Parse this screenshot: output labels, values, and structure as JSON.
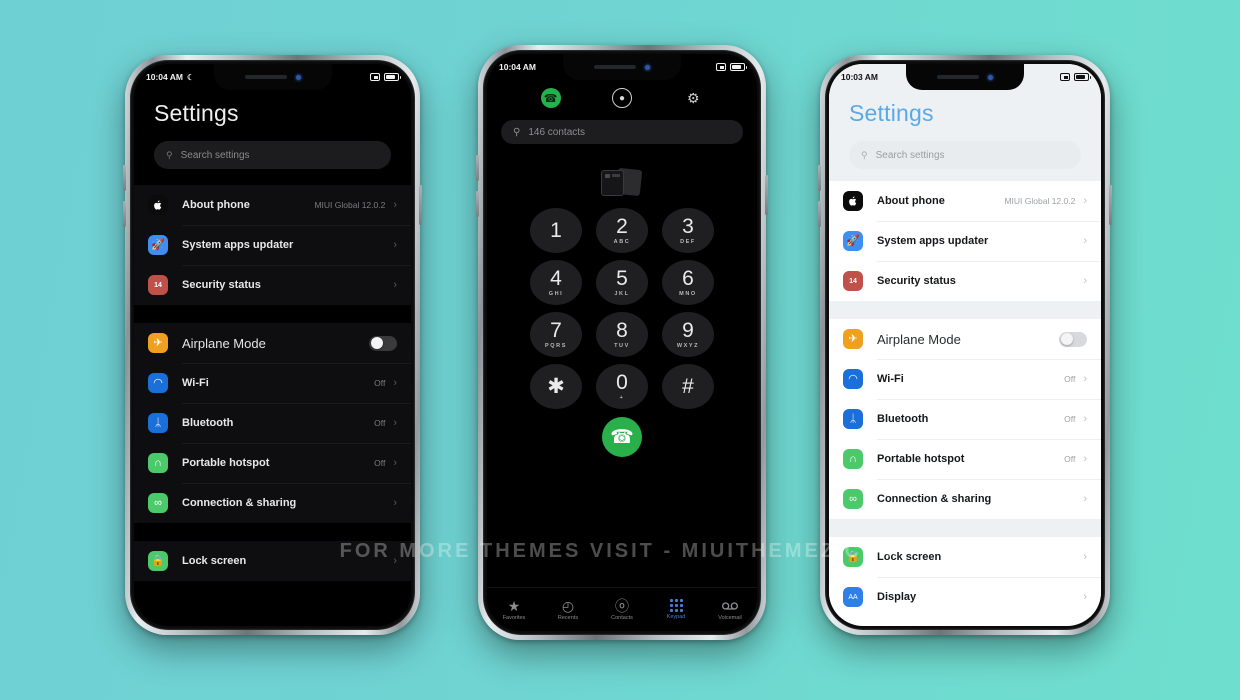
{
  "background": {
    "from": "#6FD0D4",
    "to": "#6EDECE"
  },
  "watermark": "FOR MORE THEMES VISIT - MIUITHEMEZ.COM",
  "phones": {
    "left": {
      "statusbar": {
        "time": "10:04 AM",
        "dnd_icon": "moon-icon",
        "right_icon": "screenshot-icon",
        "battery": "battery-icon"
      },
      "title": "Settings",
      "search_placeholder": "Search settings",
      "groups": [
        {
          "rows": [
            {
              "label": "About phone",
              "value": "MIUI Global 12.0.2",
              "icon": "apple-icon",
              "icon_bg": "#0b0b0b",
              "glyph": "",
              "chevron": "›"
            },
            {
              "label": "System apps updater",
              "value": "",
              "icon": "rocket-icon",
              "icon_bg": "#3f8ff0",
              "glyph": "🚀",
              "chevron": "›"
            },
            {
              "label": "Security status",
              "value": "",
              "icon": "security-14-icon",
              "icon_bg": "#c0504a",
              "glyph": "14",
              "chevron": "›"
            }
          ]
        },
        {
          "rows": [
            {
              "label": "Airplane Mode",
              "value": "",
              "icon": "airplane-icon",
              "icon_bg": "#f0a020",
              "glyph": "✈",
              "toggle": true,
              "light": true
            },
            {
              "label": "Wi-Fi",
              "value": "Off",
              "icon": "wifi-icon",
              "icon_bg": "#1b6fd8",
              "glyph": "◠",
              "chevron": "›"
            },
            {
              "label": "Bluetooth",
              "value": "Off",
              "icon": "bluetooth-icon",
              "icon_bg": "#1b6fd8",
              "glyph": "ᛦ",
              "chevron": "›"
            },
            {
              "label": "Portable hotspot",
              "value": "Off",
              "icon": "hotspot-icon",
              "icon_bg": "#4cc96a",
              "glyph": "∩",
              "chevron": "›"
            },
            {
              "label": "Connection & sharing",
              "value": "",
              "icon": "connection-sharing-icon",
              "icon_bg": "#4cc96a",
              "glyph": "∞",
              "chevron": "›"
            }
          ]
        },
        {
          "rows": [
            {
              "label": "Lock screen",
              "value": "",
              "icon": "lock-screen-icon",
              "icon_bg": "#4cc96a",
              "glyph": "🔒",
              "chevron": "›"
            }
          ]
        }
      ]
    },
    "middle": {
      "statusbar": {
        "time": "10:04 AM",
        "right_icon": "screenshot-icon",
        "battery": "battery-icon"
      },
      "header_icons": [
        {
          "name": "phone-icon",
          "glyph": "✆"
        },
        {
          "name": "contact-icon",
          "glyph": "●"
        },
        {
          "name": "gear-icon",
          "glyph": "⚙"
        }
      ],
      "search_text": "146 contacts",
      "keys": [
        {
          "num": "1",
          "letters": ""
        },
        {
          "num": "2",
          "letters": "ABC"
        },
        {
          "num": "3",
          "letters": "DEF"
        },
        {
          "num": "4",
          "letters": "GHI"
        },
        {
          "num": "5",
          "letters": "JKL"
        },
        {
          "num": "6",
          "letters": "MNO"
        },
        {
          "num": "7",
          "letters": "PQRS"
        },
        {
          "num": "8",
          "letters": "TUV"
        },
        {
          "num": "9",
          "letters": "WXYZ"
        },
        {
          "num": "✱",
          "letters": ""
        },
        {
          "num": "0",
          "letters": "+"
        },
        {
          "num": "#",
          "letters": ""
        }
      ],
      "call_button": "call-icon",
      "tabs": [
        {
          "label": "Favorites",
          "icon": "star-icon",
          "active": false
        },
        {
          "label": "Recents",
          "icon": "clock-icon",
          "active": false
        },
        {
          "label": "Contacts",
          "icon": "person-icon",
          "active": false
        },
        {
          "label": "Keypad",
          "icon": "keypad-icon",
          "active": true
        },
        {
          "label": "Voicemail",
          "icon": "voicemail-icon",
          "active": false
        }
      ]
    },
    "right": {
      "statusbar": {
        "time": "10:03 AM",
        "right_icon": "screenshot-icon",
        "battery": "battery-icon"
      },
      "title": "Settings",
      "title_color": "#5aa9e6",
      "search_placeholder": "Search settings",
      "groups": [
        {
          "rows": [
            {
              "label": "About phone",
              "value": "MIUI Global 12.0.2",
              "icon": "apple-icon",
              "icon_bg": "#0b0b0b",
              "glyph": "",
              "chevron": "›"
            },
            {
              "label": "System apps updater",
              "value": "",
              "icon": "rocket-icon",
              "icon_bg": "#3f8ff0",
              "glyph": "🚀",
              "chevron": "›"
            },
            {
              "label": "Security status",
              "value": "",
              "icon": "security-14-icon",
              "icon_bg": "#c0504a",
              "glyph": "14",
              "chevron": "›"
            }
          ]
        },
        {
          "rows": [
            {
              "label": "Airplane Mode",
              "value": "",
              "icon": "airplane-icon",
              "icon_bg": "#f0a020",
              "glyph": "✈",
              "toggle": true,
              "light": true
            },
            {
              "label": "Wi-Fi",
              "value": "Off",
              "icon": "wifi-icon",
              "icon_bg": "#1b6fd8",
              "glyph": "◠",
              "chevron": "›"
            },
            {
              "label": "Bluetooth",
              "value": "Off",
              "icon": "bluetooth-icon",
              "icon_bg": "#1b6fd8",
              "glyph": "ᛦ",
              "chevron": "›"
            },
            {
              "label": "Portable hotspot",
              "value": "Off",
              "icon": "hotspot-icon",
              "icon_bg": "#4cc96a",
              "glyph": "∩",
              "chevron": "›"
            },
            {
              "label": "Connection & sharing",
              "value": "",
              "icon": "connection-sharing-icon",
              "icon_bg": "#4cc96a",
              "glyph": "∞",
              "chevron": "›"
            }
          ]
        },
        {
          "rows": [
            {
              "label": "Lock screen",
              "value": "",
              "icon": "lock-screen-icon",
              "icon_bg": "#4cc96a",
              "glyph": "🔒",
              "chevron": "›"
            },
            {
              "label": "Display",
              "value": "",
              "icon": "display-aa-icon",
              "icon_bg": "#2f7fe8",
              "glyph": "AA",
              "chevron": "›"
            }
          ]
        }
      ]
    }
  }
}
